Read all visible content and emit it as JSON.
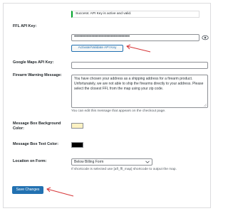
{
  "fields": {
    "ffl_api_key": {
      "label": "FFL API Key:",
      "notice": "Success: API Key is active and valid.",
      "masked_value": "•••••••••••••••••••••••••••••••••••••••••",
      "validate_button": "Activate/Validate API Key"
    },
    "google_maps_api_key": {
      "label": "Google Maps API Key:",
      "value": ""
    },
    "firearm_warning_message": {
      "label": "Firearm Warning Message:",
      "value": "You have chosen your address as a shipping address for a firearm product. Unfortunately, we are not able to ship the firearms directly to your address. Please select the closest FFL from the map using your zip code.",
      "help": "You can edit this message that appears on the checkout page."
    },
    "message_box_background_color": {
      "label": "Message Box Background Color:",
      "color": "#fdf2c3"
    },
    "message_box_text_color": {
      "label": "Message Box Text Color:",
      "color": "#000000"
    },
    "location_on_form": {
      "label": "Location on Form:",
      "selected": "Below Billing Form",
      "help": "If shortcode is selected use [afl_ffl_map] shortcode to output the map."
    }
  },
  "save_button": "Save Changes",
  "colors": {
    "accent": "#2271b1",
    "success": "#00a32a",
    "annotation_arrow": "#d63638"
  },
  "icons": {
    "password_toggle": "eye-icon",
    "select_chevron": "chevron-down-icon",
    "annotation": "red-arrow-icon"
  }
}
